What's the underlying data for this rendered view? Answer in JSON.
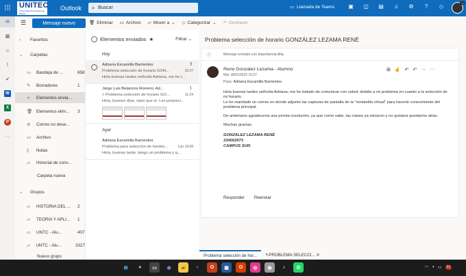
{
  "header": {
    "logo_text": "UNITEC",
    "logo_sub": "Universidad Tecnológica de México",
    "app_title": "Outlook",
    "search_placeholder": "Buscar",
    "teams_call": "Llamada de Teams",
    "avatar_badge": "+1"
  },
  "toolbar": {
    "new_mail": "Mensaje nuevo",
    "delete": "Eliminar",
    "archive": "Archivo",
    "move_to": "Mover a",
    "categorize": "Categorizar",
    "undo": "Deshacer"
  },
  "folders": {
    "favorites": "Favoritos",
    "folders_head": "Carpetas",
    "items": [
      {
        "label": "Bandeja de ...",
        "count": "658",
        "icon": "inbox-icon"
      },
      {
        "label": "Borradores",
        "count": "1",
        "icon": "pencil-icon"
      },
      {
        "label": "Elementos envia...",
        "count": "",
        "icon": "send-icon"
      },
      {
        "label": "Elementos elim...",
        "count": "3",
        "icon": "trash-icon"
      },
      {
        "label": "Correo no dese...",
        "count": "",
        "icon": "block-icon"
      },
      {
        "label": "Archivo",
        "count": "",
        "icon": "archive-icon"
      },
      {
        "label": "Notas",
        "count": "",
        "icon": "note-icon"
      },
      {
        "label": "Historial de conv...",
        "count": "",
        "icon": "folder-icon"
      }
    ],
    "new_folder": "Carpeta nueva",
    "groups_head": "Grupos",
    "groups": [
      {
        "label": "HISTORIA DEL ...",
        "count": "2"
      },
      {
        "label": "TEORIA Y APLI...",
        "count": "1"
      },
      {
        "label": "UNTC - Alu...",
        "count": "407"
      },
      {
        "label": "UNTC - Alu...",
        "count": "3327"
      }
    ],
    "new_group": "Nuevo grupo"
  },
  "list": {
    "title": "Elementos enviados",
    "filter": "Filtrar",
    "group_today": "Hoy",
    "group_yesterday": "Ayer",
    "messages": [
      {
        "sender": "Adriana Escamilla Barrientos",
        "subject": "Problema selección de horario GON...",
        "time": "16:27",
        "preview": "Hola buenas tardes señorita Adriana, me he t..."
      },
      {
        "sender": "Jorge Luis Betanzos Romero; Ad...",
        "subject": "> Problema selección de horario GO...",
        "time": "11:24",
        "preview": "Hola, buenos días, claro que sí. Les proporci..."
      },
      {
        "sender": "Adriana Escamilla Barrientos",
        "subject": "Problema para selección de horario...",
        "time": "Lun 19:08",
        "preview": "Hola, buenas tarde, tengo un problema y q..."
      }
    ]
  },
  "reading": {
    "title": "Problema selección de horario GONZÁLEZ LEZAMA RENÉ",
    "importance": "Mensaje enviado con Importancia Alta.",
    "sender": "Rene Gonzalez Lezama - Alumno",
    "date": "Mar 18/01/2022 16:27",
    "to_label": "Para:",
    "to": "Adriana Escamilla Barrientos",
    "p1": "Hola buenas tardes señorita Adriana, me he tratado de comunicar con usted, debido a mi problema en cuanto a la selección de mi horario.",
    "p1b": "Le he mandado un correo en donde adjunto las capturas de pantalla de la \"ventanilla virtual\" para hacerle conocimiento del problema principal.",
    "p2": "De antemano agradecería una pronta resolución, ya que como sabe, las clases ya iniciaron y no quisiera quedarme atrás.",
    "p3": "Muchas gracias.",
    "sig1": "GONZALEZ LEZAMA RENÉ",
    "sig2": "334002573",
    "sig3": "CAMPUS SUR.",
    "reply": "Responder",
    "forward": "Reenviar"
  },
  "tabs": [
    {
      "label": "Problema selección de hor..."
    },
    {
      "label": "PROBLEMA SELECCI..."
    }
  ],
  "taskbar": {
    "notif": "21"
  }
}
